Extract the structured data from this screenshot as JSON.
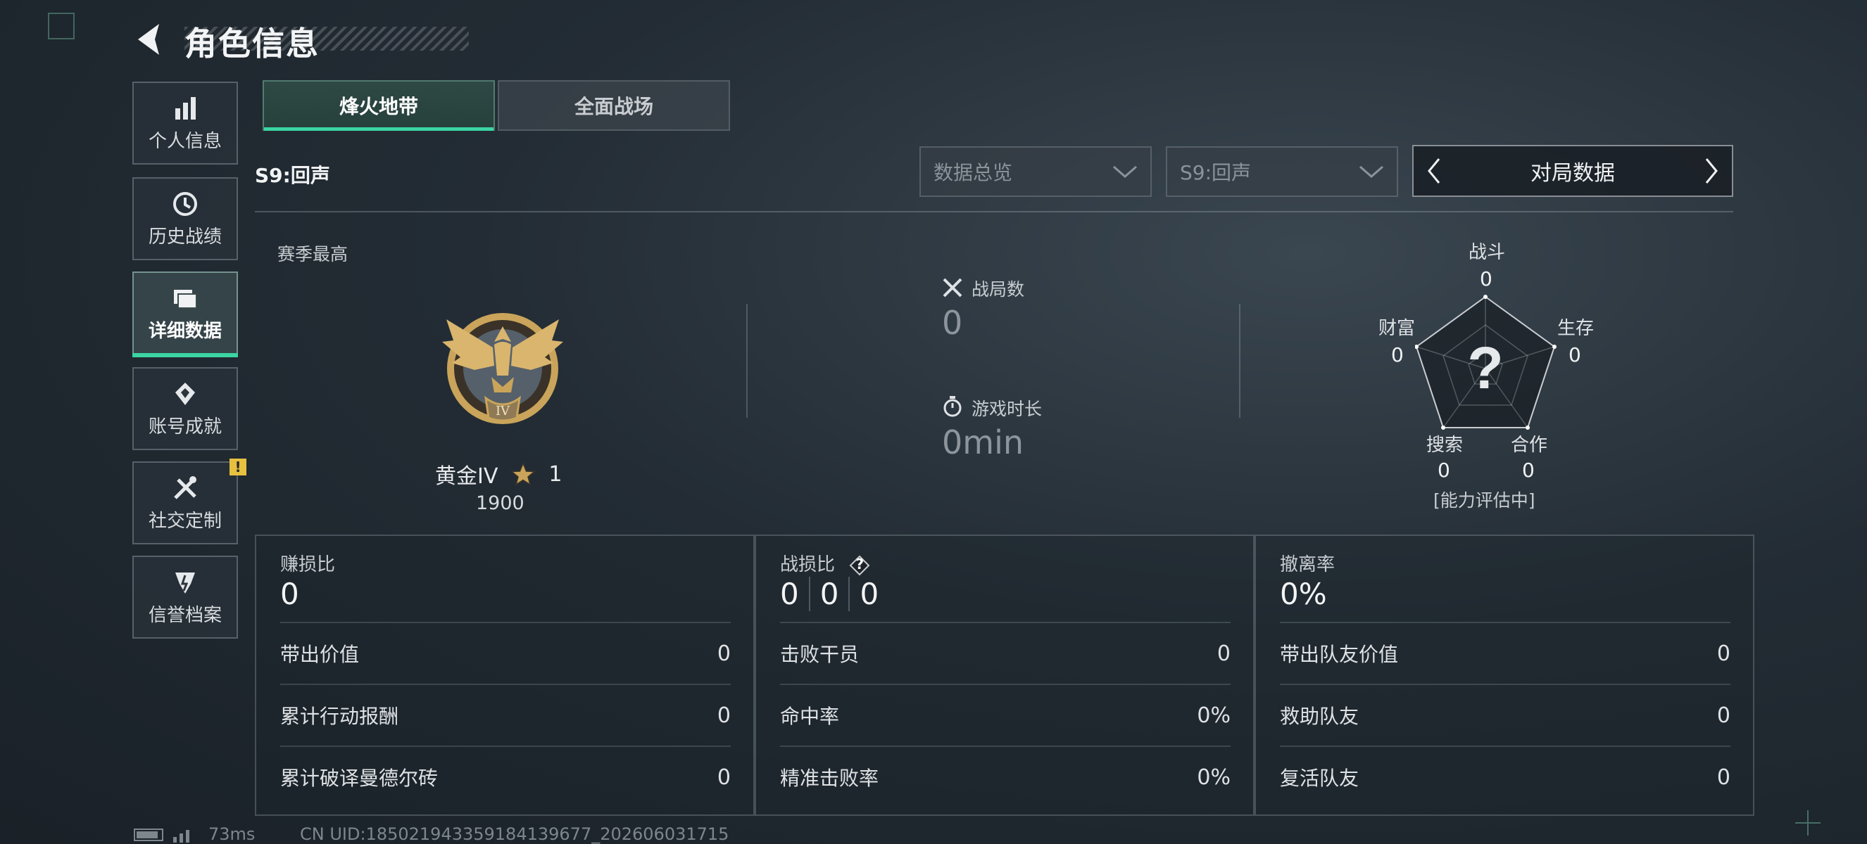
{
  "header": {
    "title": "角色信息"
  },
  "sidebar": {
    "items": [
      {
        "label": "个人信息",
        "icon": "bar-chart-icon",
        "active": false
      },
      {
        "label": "历史战绩",
        "icon": "history-icon",
        "active": false
      },
      {
        "label": "详细数据",
        "icon": "folder-icon",
        "active": true
      },
      {
        "label": "账号成就",
        "icon": "achievement-icon",
        "active": false
      },
      {
        "label": "社交定制",
        "icon": "tools-icon",
        "active": false,
        "badge": "!"
      },
      {
        "label": "信誉档案",
        "icon": "credit-icon",
        "active": false
      }
    ]
  },
  "tabs": [
    {
      "label": "烽火地带",
      "active": true
    },
    {
      "label": "全面战场",
      "active": false
    }
  ],
  "season_label": "S9:回声",
  "filters": {
    "overview": "数据总览",
    "season": "S9:回声",
    "pager_label": "对局数据"
  },
  "season_best": {
    "label": "赛季最高",
    "rank": "黄金IV",
    "stars": "1",
    "score": "1900"
  },
  "matches": {
    "label": "战局数",
    "value": "0"
  },
  "playtime": {
    "label": "游戏时长",
    "value": "0min"
  },
  "radar": {
    "question": "?",
    "status": "[能力评估中]",
    "axes": [
      {
        "label": "战斗",
        "value": "0"
      },
      {
        "label": "生存",
        "value": "0"
      },
      {
        "label": "合作",
        "value": "0"
      },
      {
        "label": "搜索",
        "value": "0"
      },
      {
        "label": "财富",
        "value": "0"
      }
    ]
  },
  "boxes": [
    {
      "title": "赚损比",
      "big": "0",
      "rows": [
        {
          "label": "带出价值",
          "value": "0"
        },
        {
          "label": "累计行动报酬",
          "value": "0"
        },
        {
          "label": "累计破译曼德尔砖",
          "value": "0"
        }
      ]
    },
    {
      "title": "战损比",
      "help": "?",
      "big_parts": [
        "0",
        "0",
        "0"
      ],
      "rows": [
        {
          "label": "击败干员",
          "value": "0"
        },
        {
          "label": "命中率",
          "value": "0%"
        },
        {
          "label": "精准击败率",
          "value": "0%"
        }
      ]
    },
    {
      "title": "撤离率",
      "big": "0%",
      "rows": [
        {
          "label": "带出队友价值",
          "value": "0"
        },
        {
          "label": "救助队友",
          "value": "0"
        },
        {
          "label": "复活队友",
          "value": "0"
        }
      ]
    }
  ],
  "footer": {
    "ping": "73ms",
    "uid": "CN UID:18502194335918413967​7_202606031715"
  },
  "colors": {
    "accent": "#3bd4a2",
    "warning": "#e8c040",
    "gold": "#c9a45a"
  }
}
